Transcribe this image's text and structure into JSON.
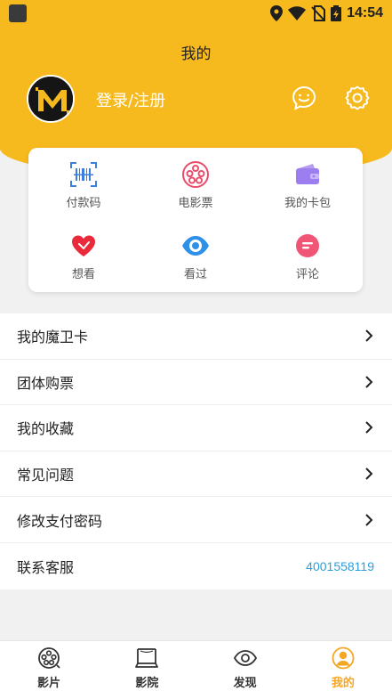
{
  "status_bar": {
    "time": "14:54"
  },
  "header": {
    "title": "我的",
    "login_text": "登录/注册",
    "accent_color": "#f7ba1e"
  },
  "quick_actions": [
    {
      "label": "付款码",
      "icon": "barcode-icon"
    },
    {
      "label": "电影票",
      "icon": "film-reel-icon"
    },
    {
      "label": "我的卡包",
      "icon": "wallet-icon"
    },
    {
      "label": "想看",
      "icon": "heart-icon"
    },
    {
      "label": "看过",
      "icon": "eye-icon"
    },
    {
      "label": "评论",
      "icon": "comment-icon"
    }
  ],
  "menu": {
    "items": [
      {
        "label": "我的魔卫卡"
      },
      {
        "label": "团体购票"
      },
      {
        "label": "我的收藏"
      },
      {
        "label": "常见问题"
      },
      {
        "label": "修改支付密码"
      }
    ],
    "contact": {
      "label": "联系客服",
      "phone": "4001558119",
      "phone_color": "#2a9fd8"
    }
  },
  "tabbar": {
    "tabs": [
      {
        "label": "影片",
        "icon": "film-reel-icon"
      },
      {
        "label": "影院",
        "icon": "cinema-screen-icon"
      },
      {
        "label": "发现",
        "icon": "eye-icon"
      },
      {
        "label": "我的",
        "icon": "user-icon",
        "active": true
      }
    ],
    "active_color": "#f5a623"
  }
}
